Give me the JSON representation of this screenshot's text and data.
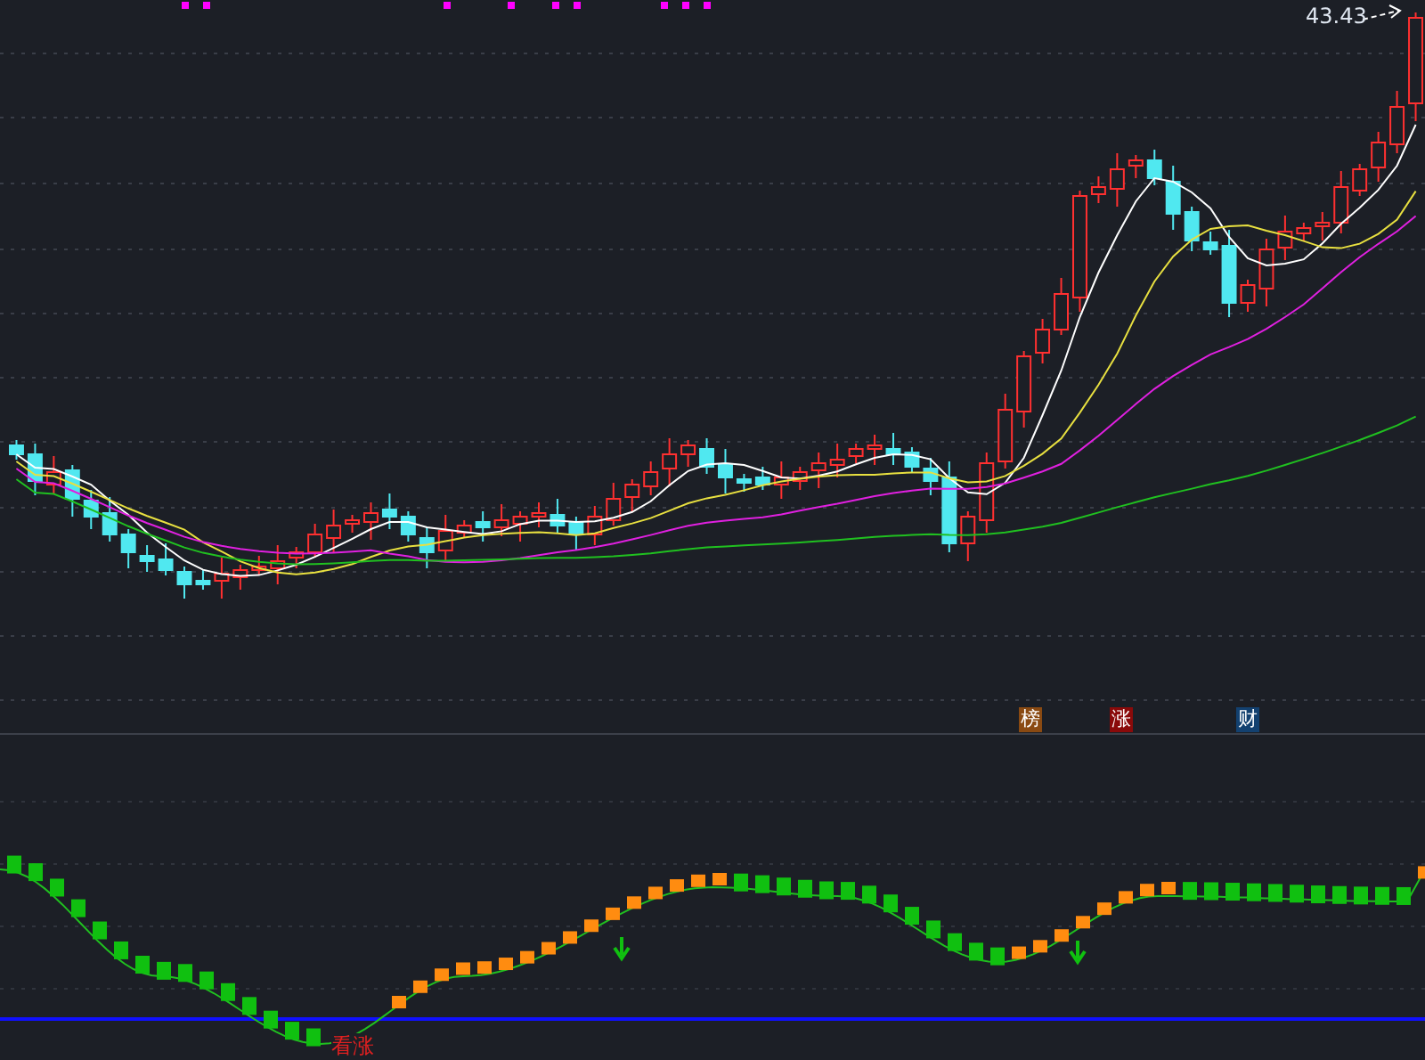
{
  "price_label": "43.43",
  "badges": [
    {
      "text": "榜",
      "color": "#8a4a12"
    },
    {
      "text": "涨",
      "color": "#8a0a0a"
    },
    {
      "text": "财",
      "color": "#134170"
    }
  ],
  "signal_label": "看涨"
}
